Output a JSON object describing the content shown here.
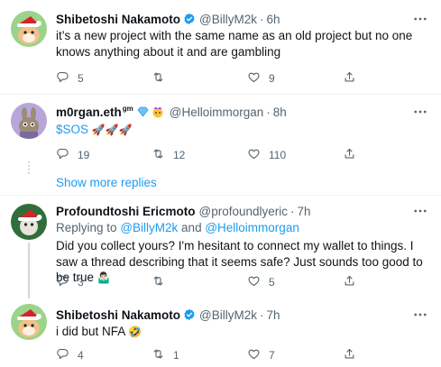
{
  "tweets": [
    {
      "name": "Shibetoshi Nakamoto",
      "handle": "@BillyM2k",
      "time": "6h",
      "text": "it’s a new project with the same name as an old project but no one knows anything about it and are gambling",
      "reply_count": "5",
      "retweet_count": "",
      "like_count": "9"
    },
    {
      "name": "m0rgan.eth",
      "name_suffix": "gm",
      "handle": "@Helloimmorgan",
      "time": "8h",
      "text": "$SOS",
      "emoji": "🚀🚀🚀",
      "reply_count": "19",
      "retweet_count": "12",
      "like_count": "110"
    },
    {
      "name": "Profoundtoshi Ericmoto",
      "handle": "@profoundlyeric",
      "time": "7h",
      "replying_prefix": "Replying to",
      "replying_to_1": "@BillyM2k",
      "replying_and": "and",
      "replying_to_2": "@Helloimmorgan",
      "text": "Did you collect yours? I'm hesitant to connect my wallet to things. I saw a thread describing that it seems safe? Just sounds too good to be true",
      "emoji": "🤷🏻‍♂️",
      "reply_count": "3",
      "retweet_count": "",
      "like_count": "5"
    },
    {
      "name": "Shibetoshi Nakamoto",
      "handle": "@BillyM2k",
      "time": "7h",
      "text": "i did but NFA",
      "emoji": "🤣",
      "reply_count": "4",
      "retweet_count": "1",
      "like_count": "7"
    }
  ],
  "show_more_replies": "Show more replies",
  "separator_dot": "·",
  "colors": {
    "accent": "#1d9bf0",
    "muted": "#536471",
    "text": "#0f1419",
    "border": "#eff3f4"
  },
  "icons": [
    "verified-badge-icon",
    "more-icon",
    "reply-icon",
    "retweet-icon",
    "like-icon",
    "share-icon"
  ]
}
